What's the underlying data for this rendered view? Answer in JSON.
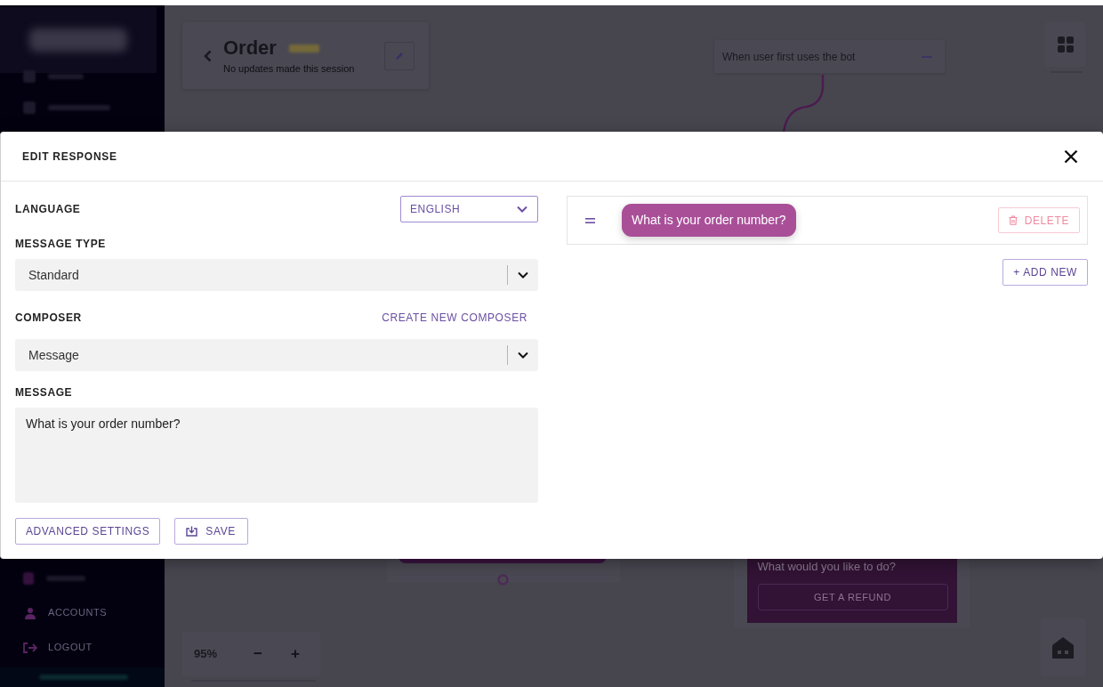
{
  "sidebar": {
    "items": [
      {
        "label": "ACCOUNTS"
      },
      {
        "label": "LOGOUT"
      }
    ]
  },
  "header": {
    "title": "Order",
    "subtitle": "No updates made this session"
  },
  "canvas": {
    "trigger": "When user first uses the bot",
    "node_message": "What would you like to do?",
    "node_button": "GET A REFUND",
    "zoom_level": "95%",
    "zoom_out": "−",
    "zoom_in": "+"
  },
  "modal": {
    "title": "EDIT RESPONSE",
    "language": {
      "label": "LANGUAGE",
      "value": "ENGLISH"
    },
    "message_type": {
      "label": "MESSAGE TYPE",
      "value": "Standard"
    },
    "composer": {
      "label": "COMPOSER",
      "link": "CREATE NEW COMPOSER",
      "value": "Message"
    },
    "message": {
      "label": "MESSAGE",
      "value": "What is your order number?"
    },
    "buttons": [
      {
        "label": "ADVANCED SETTINGS",
        "kind": "plain"
      },
      {
        "label": "SAVE",
        "kind": "save"
      }
    ],
    "responses": [
      {
        "text": "What is your order number?",
        "action": "DELETE"
      }
    ],
    "add_button": "+ ADD NEW"
  }
}
